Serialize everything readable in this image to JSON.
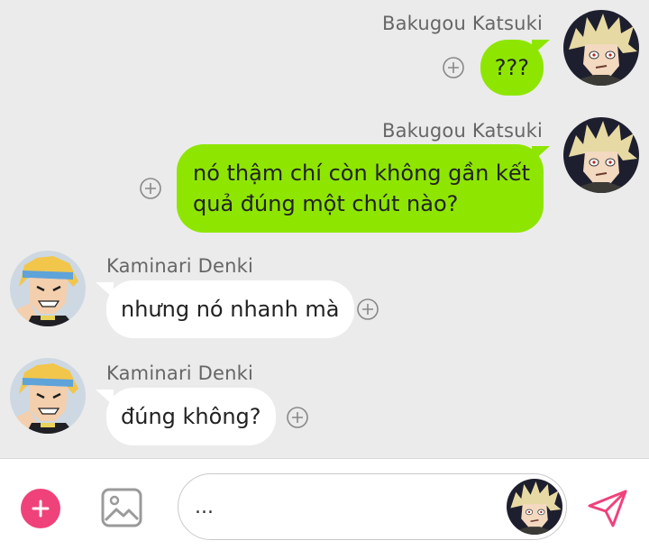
{
  "messages": [
    {
      "sender": "Bakugou Katsuki",
      "direction": "outgoing",
      "lines": [
        "???"
      ]
    },
    {
      "sender": "Bakugou Katsuki",
      "direction": "outgoing",
      "lines": [
        "nó thậm chí còn không gần kết",
        "quả đúng một chút nào?"
      ]
    },
    {
      "sender": "Kaminari Denki",
      "direction": "incoming",
      "lines": [
        "nhưng nó nhanh mà"
      ]
    },
    {
      "sender": "Kaminari Denki",
      "direction": "incoming",
      "lines": [
        "đúng không?"
      ]
    }
  ],
  "composer": {
    "input_value": "...",
    "add_icon": "plus-icon",
    "image_icon": "image-icon",
    "send_icon": "send-icon"
  },
  "colors": {
    "outgoing_bubble": "#8ee600",
    "incoming_bubble": "#ffffff",
    "background": "#ebebeb",
    "accent": "#f0427a"
  }
}
